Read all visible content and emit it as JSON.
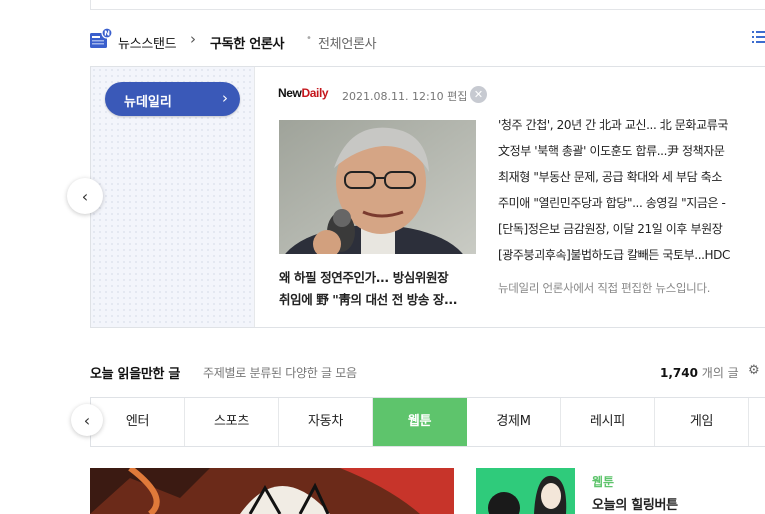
{
  "newsstand": {
    "title": "뉴스스탠드",
    "chevron": "›",
    "subscribed": "구독한 언론사",
    "all": "전체언론사",
    "press_button": "뉴데일리",
    "press_button_arrow": "›",
    "press_logo_a": "New",
    "press_logo_b": "Daily",
    "edit_time": "2021.08.11. 12:10 편집",
    "close_glyph": "✕",
    "prev_glyph": "‹",
    "headline_caption_1": "왜 하필 정연주인가... 방심위원장",
    "headline_caption_2": "취임에 野 \"靑의 대선 전 방송 장...",
    "headlines": [
      "'청주 간첩', 20년 간 北과 교신... 北 문화교류국",
      "文정부 '북핵 총괄' 이도훈도 합류...尹 정책자문",
      "최재형 \"부동산 문제, 공급 확대와 세 부담 축소",
      "주미애 \"열린민주당과 합당\"... 송영길 \"지금은 -",
      "[단독]정은보 금감원장, 이달 21일 이후 부원장",
      "[광주붕괴후속]불법하도급 칼빼든 국토부...HDC"
    ],
    "footer": "뉴데일리 언론사에서 직접 편집한 뉴스입니다."
  },
  "reading": {
    "title": "오늘 읽을만한 글",
    "subtitle": "주제별로 분류된 다양한 글 모음",
    "count_value": "1,740",
    "count_suffix": " 개의 글",
    "prev_glyph": "‹",
    "tabs": [
      "엔터",
      "스포츠",
      "자동차",
      "웹툰",
      "경제M",
      "레시피",
      "게임"
    ],
    "active_tab": "웹툰",
    "card_category": "웹툰",
    "card_title": "오늘의 힐링버튼"
  },
  "colors": {
    "accent_blue": "#3a59b8",
    "active_green": "#5ec46c",
    "press_red": "#c4161c"
  }
}
